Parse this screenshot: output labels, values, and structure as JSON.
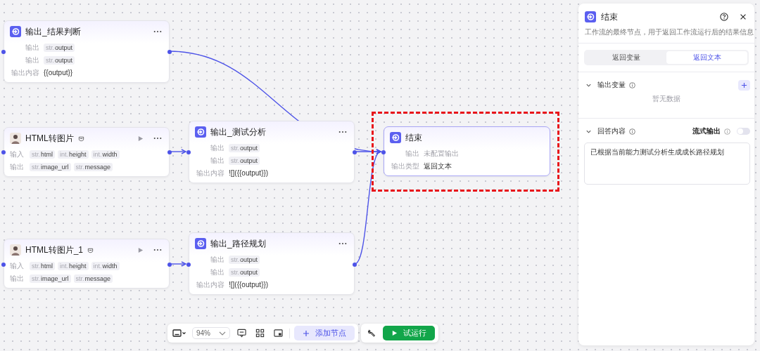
{
  "canvas": {
    "nodes": [
      {
        "kind": "output",
        "title": "输出_结果判断",
        "selected": false,
        "rows": [
          {
            "kind": "chips",
            "label": "输出",
            "chips": [
              {
                "type": "str.",
                "name": "output"
              }
            ]
          },
          {
            "kind": "chips",
            "label": "输出",
            "chips": [
              {
                "type": "str.",
                "name": "output"
              }
            ]
          },
          {
            "kind": "text",
            "label": "输出内容",
            "value": "{{output}}"
          }
        ]
      },
      {
        "kind": "html",
        "title": "HTML转图片",
        "selected": false,
        "rows": [
          {
            "kind": "chips",
            "label": "输入",
            "chips": [
              {
                "type": "str.",
                "name": "html"
              },
              {
                "type": "int.",
                "name": "height"
              },
              {
                "type": "int.",
                "name": "width"
              }
            ]
          },
          {
            "kind": "chips",
            "label": "输出",
            "chips": [
              {
                "type": "str.",
                "name": "image_url"
              },
              {
                "type": "str.",
                "name": "message"
              }
            ]
          }
        ]
      },
      {
        "kind": "output",
        "title": "输出_测试分析",
        "selected": false,
        "rows": [
          {
            "kind": "chips",
            "label": "输出",
            "chips": [
              {
                "type": "str.",
                "name": "output"
              }
            ]
          },
          {
            "kind": "chips",
            "label": "输出",
            "chips": [
              {
                "type": "str.",
                "name": "output"
              }
            ]
          },
          {
            "kind": "text",
            "label": "输出内容",
            "value": "![]({{output}})"
          }
        ]
      },
      {
        "kind": "html",
        "title": "HTML转图片_1",
        "selected": false,
        "rows": [
          {
            "kind": "chips",
            "label": "输入",
            "chips": [
              {
                "type": "str.",
                "name": "html"
              },
              {
                "type": "int.",
                "name": "height"
              },
              {
                "type": "int.",
                "name": "width"
              }
            ]
          },
          {
            "kind": "chips",
            "label": "输出",
            "chips": [
              {
                "type": "str.",
                "name": "image_url"
              },
              {
                "type": "str.",
                "name": "message"
              }
            ]
          }
        ]
      },
      {
        "kind": "output",
        "title": "输出_路径规划",
        "selected": false,
        "rows": [
          {
            "kind": "chips",
            "label": "输出",
            "chips": [
              {
                "type": "str.",
                "name": "output"
              }
            ]
          },
          {
            "kind": "chips",
            "label": "输出",
            "chips": [
              {
                "type": "str.",
                "name": "output"
              }
            ]
          },
          {
            "kind": "text",
            "label": "输出内容",
            "value": "![]({{output}})"
          }
        ]
      },
      {
        "kind": "end",
        "title": "结束",
        "selected": true,
        "highlighted": true,
        "rows": [
          {
            "kind": "muted",
            "label": "输出",
            "placeholder": "未配置输出"
          },
          {
            "kind": "text",
            "label": "输出类型",
            "value": "返回文本"
          }
        ]
      }
    ]
  },
  "panel": {
    "title": "结束",
    "description": "工作流的最终节点，用于返回工作流运行后的结果信息",
    "tabs": [
      {
        "label": "返回变量",
        "selected": false
      },
      {
        "label": "返回文本",
        "selected": true
      }
    ],
    "variables": {
      "title": "输出变量",
      "expanded": true,
      "empty_text": "暂无数据"
    },
    "answer": {
      "title": "回答内容",
      "expanded": true,
      "stream_label": "流式输出",
      "stream_on": false,
      "value": "已根据当前能力测试分析生成成长路径规划"
    }
  },
  "toolbar": {
    "zoom": "94%",
    "add_label": "添加节点",
    "run_label": "试运行"
  }
}
